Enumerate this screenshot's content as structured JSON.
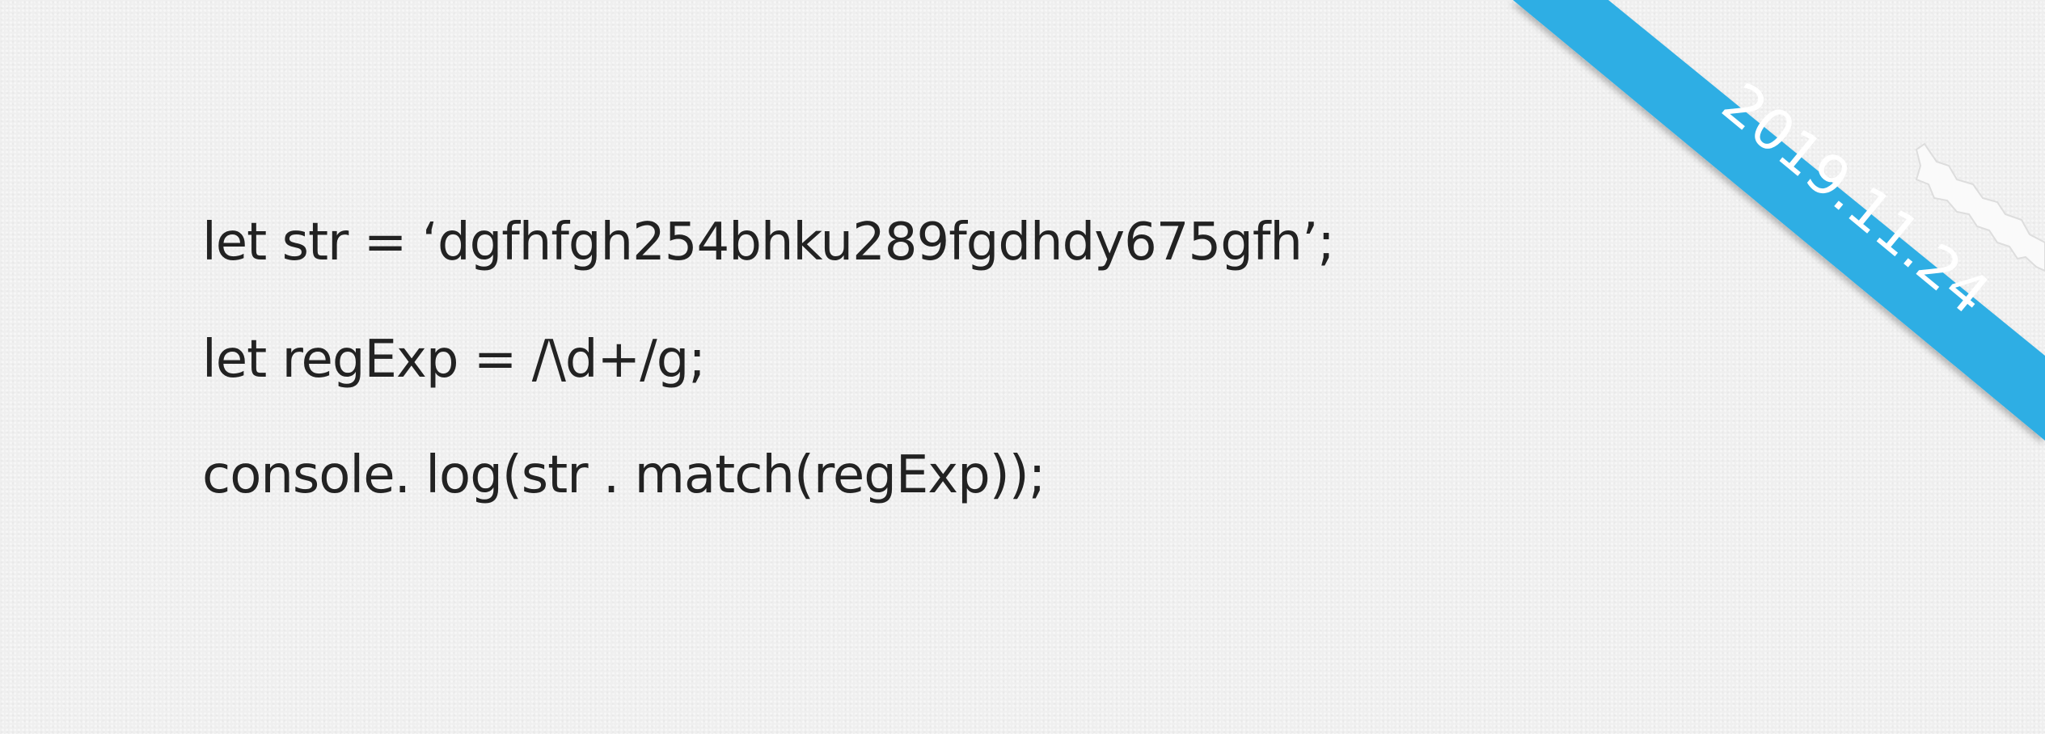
{
  "code_lines": [
    "let str = ‘dgfhfgh254bhku289fgdhdy675gfh’;",
    "let regExp = /\\d+/g;",
    "console. log(str . match(regExp));"
  ],
  "ribbon": {
    "date": "2019.11.24",
    "color": "#2eaee4"
  }
}
